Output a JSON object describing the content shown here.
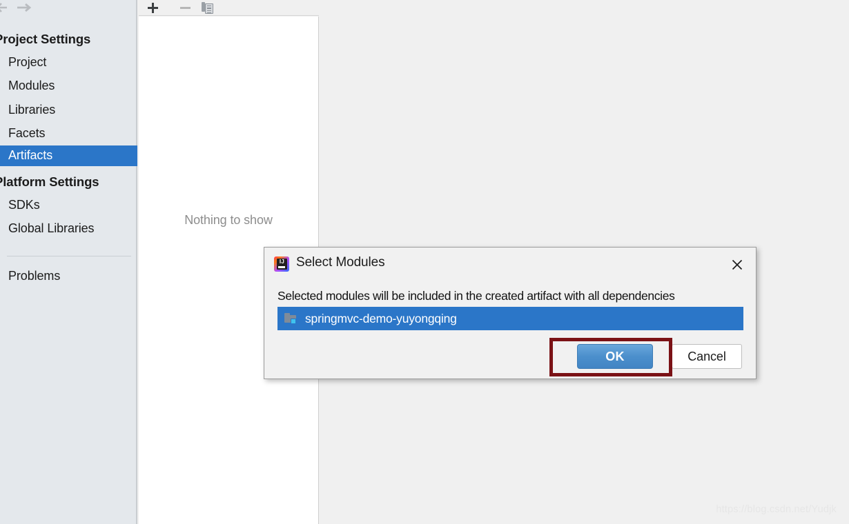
{
  "sidebar": {
    "nav": {
      "back_icon": "arrow-left-icon",
      "forward_icon": "arrow-right-icon"
    },
    "groups": [
      {
        "title": "Project Settings",
        "items": [
          {
            "label": "Project",
            "selected": false
          },
          {
            "label": "Modules",
            "selected": false
          },
          {
            "label": "Libraries",
            "selected": false
          },
          {
            "label": "Facets",
            "selected": false
          },
          {
            "label": "Artifacts",
            "selected": true
          }
        ]
      },
      {
        "title": "Platform Settings",
        "items": [
          {
            "label": "SDKs",
            "selected": false
          },
          {
            "label": "Global Libraries",
            "selected": false
          }
        ]
      }
    ],
    "footer": {
      "label": "Problems"
    }
  },
  "toolbar": {
    "add_label": "+",
    "add_icon": "plus-icon",
    "remove_label": "-",
    "remove_icon": "minus-icon",
    "copy_icon": "copy-icon"
  },
  "center_panel": {
    "empty_message": "Nothing to show"
  },
  "watermark": {
    "text": "https://blog.csdn.net/Yudjk"
  },
  "dialog": {
    "app_icon": "intellij-idea-icon",
    "app_icon_text": "IJ",
    "title": "Select Modules",
    "close_icon": "close-icon",
    "description": "Selected modules will be included in the created artifact with all dependencies",
    "modules": [
      {
        "name": "springmvc-demo-yuyongqing",
        "icon": "module-folder-icon",
        "selected": true
      }
    ],
    "buttons": {
      "ok_label": "OK",
      "cancel_label": "Cancel"
    }
  },
  "annotation": {
    "color": "#7b1216",
    "target": "ok-button"
  },
  "colors": {
    "sidebar_bg": "#e4e8ec",
    "selection_blue": "#2b76c8",
    "panel_bg": "#f0f0f0",
    "dialog_bg": "#f1f1f1",
    "ok_button_blue": "#4b8fcc",
    "annotation_red": "#7b1216"
  }
}
